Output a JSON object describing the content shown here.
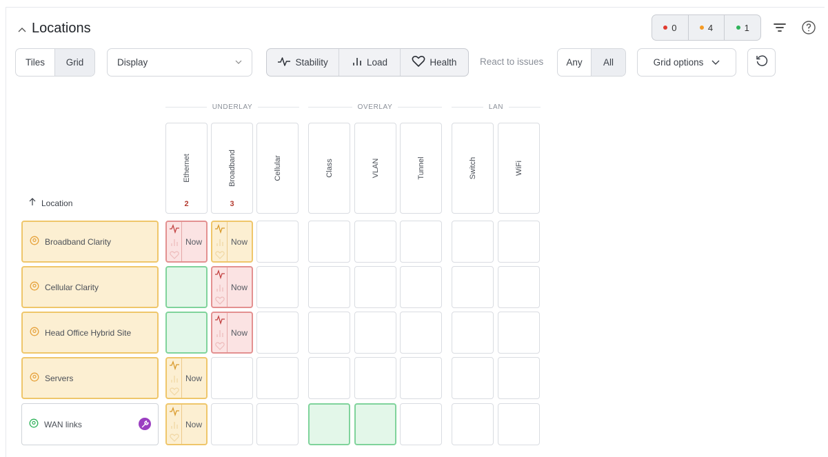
{
  "header": {
    "title": "Locations",
    "status_counts": [
      {
        "color": "#e03b2f",
        "value": "0"
      },
      {
        "color": "#f59a23",
        "value": "4"
      },
      {
        "color": "#2fb35a",
        "value": "1"
      }
    ]
  },
  "toolbar": {
    "view_options": [
      "Tiles",
      "Grid"
    ],
    "view_selected": "Grid",
    "display_value": "Display",
    "metrics": [
      "Stability",
      "Load",
      "Health"
    ],
    "react_label": "React to issues",
    "react_options": [
      "Any",
      "All"
    ],
    "react_selected": "All",
    "grid_options_label": "Grid options"
  },
  "groups": [
    "UNDERLAY",
    "OVERLAY",
    "LAN"
  ],
  "columns": [
    {
      "label": "Ethernet",
      "count": "2"
    },
    {
      "label": "Broadband",
      "count": "3"
    },
    {
      "label": "Cellular",
      "count": ""
    },
    {
      "label": "Class",
      "count": ""
    },
    {
      "label": "VLAN",
      "count": ""
    },
    {
      "label": "Tunnel",
      "count": ""
    },
    {
      "label": "Switch",
      "count": ""
    },
    {
      "label": "WiFi",
      "count": ""
    }
  ],
  "sort_label": "Location",
  "rows": [
    {
      "name": "Broadband Clarity",
      "status": "warn",
      "cells": [
        "red-now",
        "amber-now",
        "",
        "",
        "",
        "",
        "",
        ""
      ]
    },
    {
      "name": "Cellular Clarity",
      "status": "warn",
      "cells": [
        "green",
        "red-now",
        "",
        "",
        "",
        "",
        "",
        ""
      ]
    },
    {
      "name": "Head Office Hybrid Site",
      "status": "warn",
      "cells": [
        "green",
        "red-now",
        "",
        "",
        "",
        "",
        "",
        ""
      ]
    },
    {
      "name": "Servers",
      "status": "warn",
      "cells": [
        "amber-now",
        "",
        "",
        "",
        "",
        "",
        "",
        ""
      ]
    },
    {
      "name": "WAN links",
      "status": "ok",
      "cells": [
        "amber-now",
        "",
        "",
        "green",
        "green",
        "",
        "",
        ""
      ]
    }
  ],
  "now_label": "Now"
}
